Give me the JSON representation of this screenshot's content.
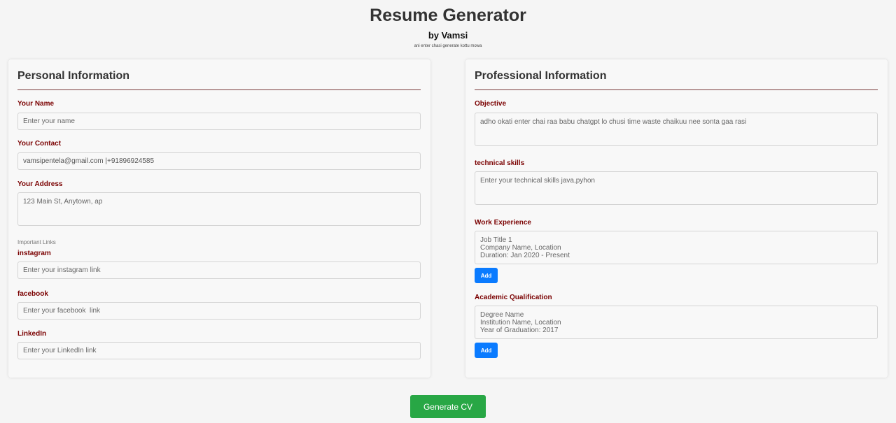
{
  "header": {
    "title": "Resume Generator",
    "author": "by Vamsi",
    "tagline": "ani enter chasi generate kottu mowa"
  },
  "personal": {
    "title": "Personal Information",
    "name": {
      "label": "Your Name",
      "placeholder": "Enter your name",
      "value": ""
    },
    "contact": {
      "label": "Your Contact",
      "placeholder": "",
      "value": "vamsipentela@gmail.com |+91896924585"
    },
    "address": {
      "label": "Your Address",
      "placeholder": "123 Main St, Anytown, ap",
      "value": ""
    },
    "links_hint": "Important Links",
    "instagram": {
      "label": "instagram",
      "placeholder": "Enter your instagram link",
      "value": ""
    },
    "facebook": {
      "label": "facebook",
      "placeholder": "Enter your facebook  link",
      "value": ""
    },
    "linkedin": {
      "label": "LinkedIn",
      "placeholder": "Enter your LinkedIn link",
      "value": ""
    }
  },
  "professional": {
    "title": "Professional Information",
    "objective": {
      "label": "Objective",
      "placeholder": "adho okati enter chai raa babu chatgpt lo chusi time waste chaikuu nee sonta gaa rasi",
      "value": ""
    },
    "skills": {
      "label": "technical skills",
      "placeholder": "Enter your technical skills java,pyhon",
      "value": ""
    },
    "experience": {
      "label": "Work Experience",
      "placeholder": "Job Title 1\nCompany Name, Location\nDuration: Jan 2020 - Present",
      "value": "",
      "add_label": "Add"
    },
    "academic": {
      "label": "Academic Qualification",
      "placeholder": "Degree Name\nInstitution Name, Location\nYear of Graduation: 2017",
      "value": "",
      "add_label": "Add"
    }
  },
  "actions": {
    "generate_label": "Generate CV"
  },
  "colors": {
    "label": "#7a0000",
    "add_button": "#0a7bff",
    "generate_button": "#28a745"
  }
}
